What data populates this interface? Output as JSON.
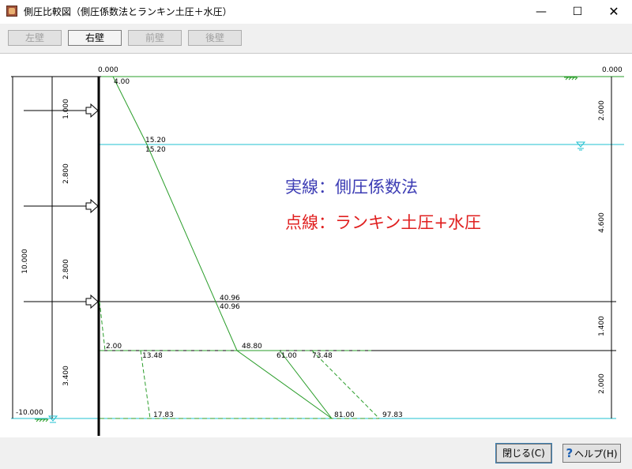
{
  "window": {
    "title": "側圧比較図（側圧係数法とランキン土圧＋水圧）",
    "controls": {
      "minimize": "—",
      "maximize": "☐",
      "close": "✕"
    }
  },
  "tabs": [
    {
      "label": "左壁",
      "active": false
    },
    {
      "label": "右壁",
      "active": true
    },
    {
      "label": "前壁",
      "active": false
    },
    {
      "label": "後壁",
      "active": false
    }
  ],
  "diagram": {
    "top_left_elevation": "0.000",
    "top_right_elevation": "0.000",
    "bottom_left_elevation": "-10.000",
    "left_total_dim": "10.000",
    "left_dims": [
      "1.000",
      "2.800",
      "2.800",
      "3.400"
    ],
    "right_dims": [
      "2.000",
      "4.600",
      "1.400",
      "2.000"
    ],
    "legend_solid": "実線：側圧係数法",
    "legend_dashed": "点線：ランキン土圧+水圧",
    "legend_solid_color": "#3c3cb4",
    "legend_dashed_color": "#e02020",
    "values": {
      "v_top": "4.00",
      "v_wl_a": "15.20",
      "v_wl_b": "15.20",
      "v_mid_a": "40.96",
      "v_mid_b": "40.96",
      "v_low_solid": "48.80",
      "v_low_left": "2.00",
      "v_low_dash1": "13.48",
      "v_low_solid2": "61.00",
      "v_low_dash2": "73.48",
      "v_bot_dash1": "17.83",
      "v_bot_solid": "81.00",
      "v_bot_dash2": "97.83"
    }
  },
  "buttons": {
    "close": "閉じる(C)",
    "help": "ヘルプ(H)"
  }
}
